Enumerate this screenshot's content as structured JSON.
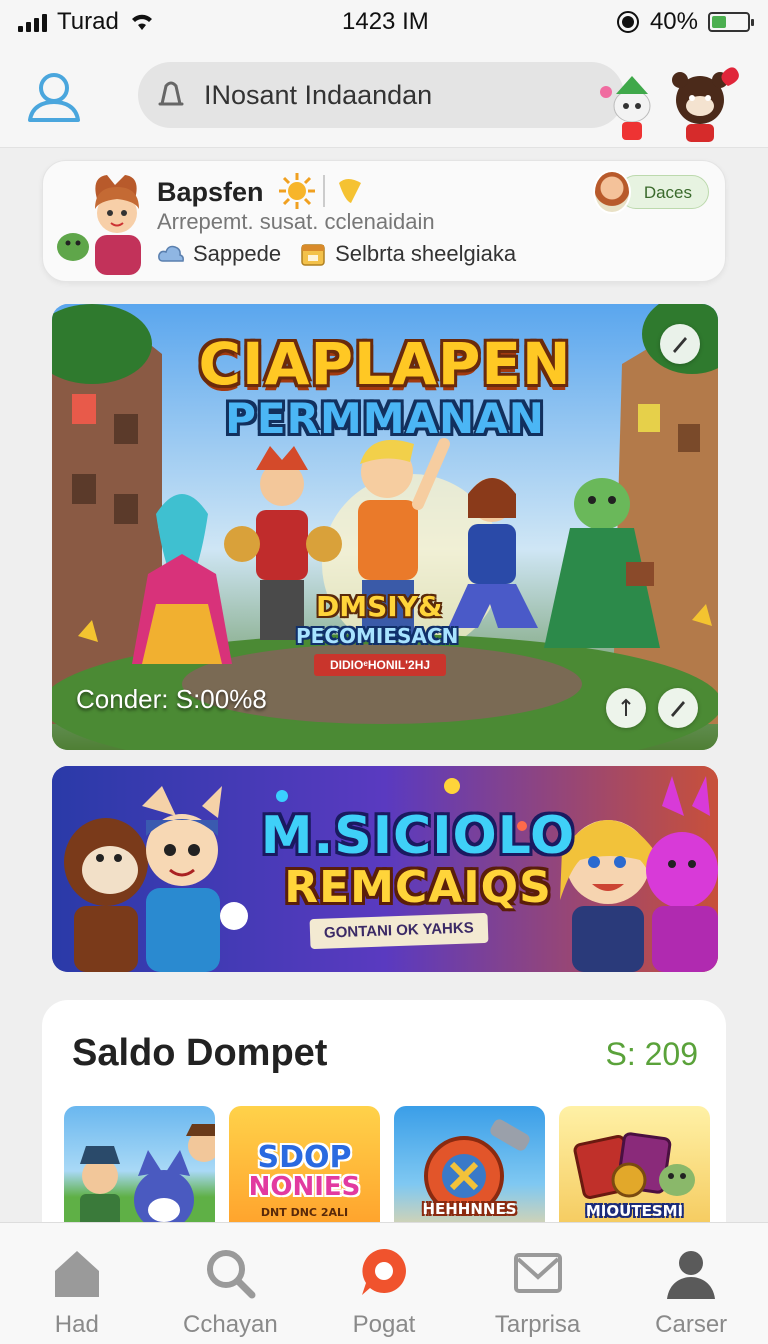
{
  "status_bar": {
    "carrier": "Turad",
    "time": "1423 IM",
    "battery": "40%"
  },
  "header": {
    "search_text": "INosant Indaandan"
  },
  "profile": {
    "name": "Bapsfen",
    "subtitle": "Arrepemt. susat. cclenaidain",
    "meta_1": "Sappede",
    "meta_2": "Selbrta sheelgiaka",
    "chip_label": "Daces"
  },
  "banner_1": {
    "title_line1": "CIAPLAPEN",
    "title_line2": "PERMMANAN",
    "subtitle_line1": "DMSIY&",
    "subtitle_line2": "PECOMIESACN",
    "ribbon": "DIDIOᵉHONIL'2HJ",
    "counter": "Conder: S:00%8"
  },
  "banner_2": {
    "title_line1": "M.SICIOLO",
    "title_line2": "REMCAIQS",
    "tag": "GONTANI OK YAHKS"
  },
  "wallet": {
    "title": "Saldo Dompet",
    "balance": "S: 209",
    "thumbs": [
      {
        "label": ""
      },
      {
        "label_1": "SDOP",
        "label_2": "NONIES",
        "label_3": "DNT DNC 2ALI"
      },
      {
        "label": "HEHHNNES"
      },
      {
        "label": "MIOUTESMI"
      }
    ]
  },
  "nav": [
    {
      "label": "Had",
      "icon": "home-icon"
    },
    {
      "label": "Cchayan",
      "icon": "search-icon"
    },
    {
      "label": "Pogat",
      "icon": "chat-icon",
      "active": true
    },
    {
      "label": "Tarprisa",
      "icon": "mail-icon"
    },
    {
      "label": "Carser",
      "icon": "user-icon"
    }
  ],
  "colors": {
    "accent_orange": "#f0532d",
    "balance_green": "#5aa23a",
    "profile_blue": "#4aa6dd"
  }
}
